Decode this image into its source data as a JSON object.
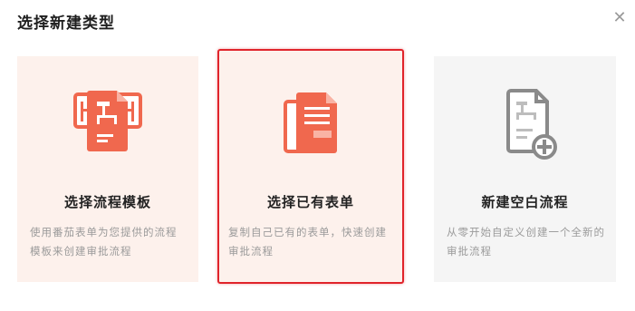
{
  "dialog": {
    "title": "选择新建类型",
    "close_icon": "close-icon"
  },
  "colors": {
    "accent": "#e0242b",
    "icon_orange": "#f0684e",
    "card_tint": "#fdf1ec",
    "card_grey": "#f5f5f5"
  },
  "cards": [
    {
      "title": "选择流程模板",
      "description": "使用番茄表单为您提供的流程模板来创建审批流程",
      "icon": "flow-templates-icon",
      "selected": false
    },
    {
      "title": "选择已有表单",
      "description": "复制自己已有的表单，快速创建审批流程",
      "icon": "copy-form-icon",
      "selected": true
    },
    {
      "title": "新建空白流程",
      "description": "从零开始自定义创建一个全新的审批流程",
      "icon": "new-blank-flow-icon",
      "selected": false
    }
  ]
}
